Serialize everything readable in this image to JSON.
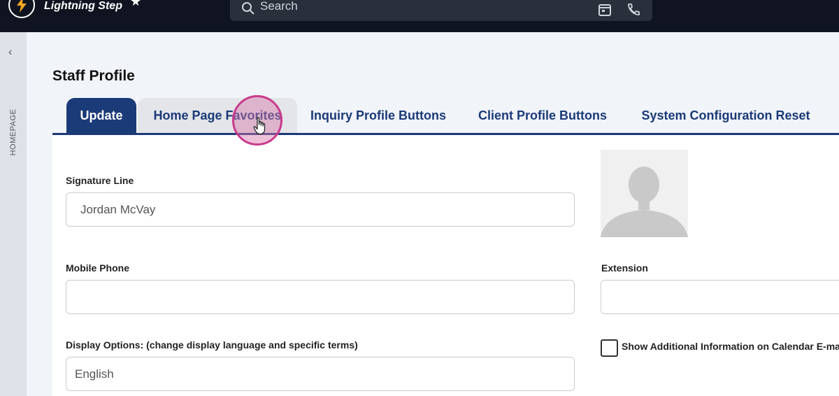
{
  "app": {
    "brand": "Lightning Step",
    "star_icon": "star-icon",
    "search_placeholder": "Search",
    "accent_color": "#1b3a78"
  },
  "sidebar": {
    "collapse_icon": "chevron-left-icon",
    "label": "HOMEPAGE"
  },
  "page": {
    "title": "Staff Profile"
  },
  "tabs": [
    {
      "label": "Update",
      "state": "active"
    },
    {
      "label": "Home Page Favorites",
      "state": "hover"
    },
    {
      "label": "Inquiry Profile Buttons",
      "state": "normal"
    },
    {
      "label": "Client Profile Buttons",
      "state": "normal"
    },
    {
      "label": "System Configuration Reset",
      "state": "normal"
    }
  ],
  "form": {
    "signature_label": "Signature Line",
    "signature_value": "Jordan McVay",
    "mobile_label": "Mobile Phone",
    "mobile_value": "",
    "extension_label": "Extension",
    "extension_value": "",
    "display_label": "Display Options: (change display language and specific terms)",
    "display_value": "English",
    "calendar_checkbox_label": "Show Additional Information on Calendar E-ma",
    "calendar_checkbox_checked": false
  }
}
